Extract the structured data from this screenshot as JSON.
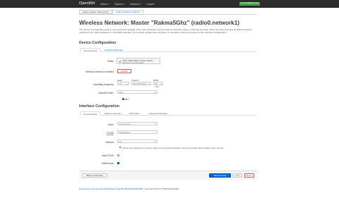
{
  "header": {
    "brand": "OpenWrt",
    "menu": [
      {
        "label": "Status"
      },
      {
        "label": "System"
      },
      {
        "label": "Network"
      },
      {
        "label": "Logout"
      }
    ],
    "autorefresh": "AUTO REFRESH ON"
  },
  "breadcrumbs": [
    {
      "label": "radio0: Master \"RakmaGhz\""
    },
    {
      "label": "radio0: Wireless \"Rakma\""
    }
  ],
  "page": {
    "title": "Wireless Network: Master \"Rakma5Ghz\" (radio0.network1)",
    "description": "The Device Configuration section covers physical settings of the radio hardware such as channel, transmit power or antenna selection which are shared among all defined wireless networks (if the radio hardware is multi-SSID capable). Per network settings like encryption or operation mode are grouped in the Interface Configuration."
  },
  "device": {
    "section_title": "Device Configuration",
    "tabs": [
      "General Setup",
      "Advanced Settings"
    ],
    "status_label": "Status",
    "status_line1": "SSID: Rakma5Ghz | Mode: Master",
    "status_line2": "Wireless is not associated",
    "enabled_label": "Wireless network is enabled",
    "disable_button": "Disable",
    "freq_label": "Operating frequency",
    "freq_heads": {
      "mode": "Mode",
      "channel": "Channel",
      "width": "Width"
    },
    "freq_values": {
      "mode": "AC",
      "channel": "36 (5180 MHz)",
      "width": "80 MHz"
    },
    "txpower_label": "Transmit Power",
    "txpower_value": "auto",
    "dbm_text": "dBm"
  },
  "interface": {
    "section_title": "Interface Configuration",
    "tabs": [
      "General Setup",
      "Wireless Security",
      "MAC-Filter",
      "Advanced Settings"
    ],
    "mode_label": "Mode",
    "mode_value": "Access Point",
    "essid_label": "ESSID",
    "essid_value": "Rakma5Ghz",
    "network_label": "Network",
    "network_value": "lan",
    "network_help": "Choose the network(s) you want to attach to this wireless interface or fill out the create field to define a new network.",
    "hide_essid_label": "Hide ESSID",
    "wmm_label": "WMM Mode"
  },
  "actions": {
    "back": "Back to Overview",
    "save_apply": "Save & Apply",
    "save": "Save",
    "reset": "Reset"
  },
  "footer": {
    "link": "Powered by LuCI openwrt-18.06 branch (git-18.228.31946-f64b152)",
    "version": " / OpenWrt 18.06.1 r7258-5eb055306f"
  },
  "colors": {
    "accent": "#0069d6",
    "topbar": "#2d2d2d",
    "autorefresh": "#46a546",
    "danger": "#c43c35"
  }
}
